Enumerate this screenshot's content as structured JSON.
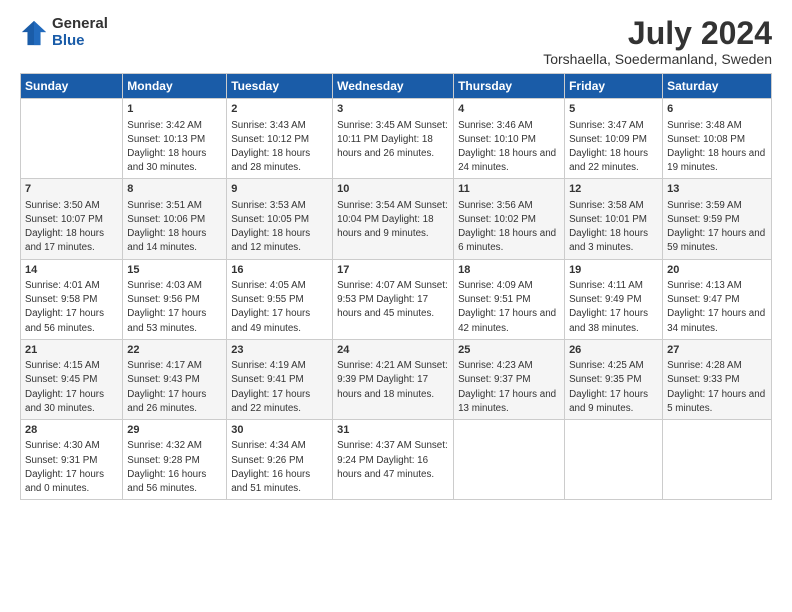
{
  "logo": {
    "general": "General",
    "blue": "Blue"
  },
  "title": "July 2024",
  "subtitle": "Torshaella, Soedermanland, Sweden",
  "days_of_week": [
    "Sunday",
    "Monday",
    "Tuesday",
    "Wednesday",
    "Thursday",
    "Friday",
    "Saturday"
  ],
  "weeks": [
    [
      {
        "num": "",
        "info": ""
      },
      {
        "num": "1",
        "info": "Sunrise: 3:42 AM\nSunset: 10:13 PM\nDaylight: 18 hours\nand 30 minutes."
      },
      {
        "num": "2",
        "info": "Sunrise: 3:43 AM\nSunset: 10:12 PM\nDaylight: 18 hours\nand 28 minutes."
      },
      {
        "num": "3",
        "info": "Sunrise: 3:45 AM\nSunset: 10:11 PM\nDaylight: 18 hours\nand 26 minutes."
      },
      {
        "num": "4",
        "info": "Sunrise: 3:46 AM\nSunset: 10:10 PM\nDaylight: 18 hours\nand 24 minutes."
      },
      {
        "num": "5",
        "info": "Sunrise: 3:47 AM\nSunset: 10:09 PM\nDaylight: 18 hours\nand 22 minutes."
      },
      {
        "num": "6",
        "info": "Sunrise: 3:48 AM\nSunset: 10:08 PM\nDaylight: 18 hours\nand 19 minutes."
      }
    ],
    [
      {
        "num": "7",
        "info": "Sunrise: 3:50 AM\nSunset: 10:07 PM\nDaylight: 18 hours\nand 17 minutes."
      },
      {
        "num": "8",
        "info": "Sunrise: 3:51 AM\nSunset: 10:06 PM\nDaylight: 18 hours\nand 14 minutes."
      },
      {
        "num": "9",
        "info": "Sunrise: 3:53 AM\nSunset: 10:05 PM\nDaylight: 18 hours\nand 12 minutes."
      },
      {
        "num": "10",
        "info": "Sunrise: 3:54 AM\nSunset: 10:04 PM\nDaylight: 18 hours\nand 9 minutes."
      },
      {
        "num": "11",
        "info": "Sunrise: 3:56 AM\nSunset: 10:02 PM\nDaylight: 18 hours\nand 6 minutes."
      },
      {
        "num": "12",
        "info": "Sunrise: 3:58 AM\nSunset: 10:01 PM\nDaylight: 18 hours\nand 3 minutes."
      },
      {
        "num": "13",
        "info": "Sunrise: 3:59 AM\nSunset: 9:59 PM\nDaylight: 17 hours\nand 59 minutes."
      }
    ],
    [
      {
        "num": "14",
        "info": "Sunrise: 4:01 AM\nSunset: 9:58 PM\nDaylight: 17 hours\nand 56 minutes."
      },
      {
        "num": "15",
        "info": "Sunrise: 4:03 AM\nSunset: 9:56 PM\nDaylight: 17 hours\nand 53 minutes."
      },
      {
        "num": "16",
        "info": "Sunrise: 4:05 AM\nSunset: 9:55 PM\nDaylight: 17 hours\nand 49 minutes."
      },
      {
        "num": "17",
        "info": "Sunrise: 4:07 AM\nSunset: 9:53 PM\nDaylight: 17 hours\nand 45 minutes."
      },
      {
        "num": "18",
        "info": "Sunrise: 4:09 AM\nSunset: 9:51 PM\nDaylight: 17 hours\nand 42 minutes."
      },
      {
        "num": "19",
        "info": "Sunrise: 4:11 AM\nSunset: 9:49 PM\nDaylight: 17 hours\nand 38 minutes."
      },
      {
        "num": "20",
        "info": "Sunrise: 4:13 AM\nSunset: 9:47 PM\nDaylight: 17 hours\nand 34 minutes."
      }
    ],
    [
      {
        "num": "21",
        "info": "Sunrise: 4:15 AM\nSunset: 9:45 PM\nDaylight: 17 hours\nand 30 minutes."
      },
      {
        "num": "22",
        "info": "Sunrise: 4:17 AM\nSunset: 9:43 PM\nDaylight: 17 hours\nand 26 minutes."
      },
      {
        "num": "23",
        "info": "Sunrise: 4:19 AM\nSunset: 9:41 PM\nDaylight: 17 hours\nand 22 minutes."
      },
      {
        "num": "24",
        "info": "Sunrise: 4:21 AM\nSunset: 9:39 PM\nDaylight: 17 hours\nand 18 minutes."
      },
      {
        "num": "25",
        "info": "Sunrise: 4:23 AM\nSunset: 9:37 PM\nDaylight: 17 hours\nand 13 minutes."
      },
      {
        "num": "26",
        "info": "Sunrise: 4:25 AM\nSunset: 9:35 PM\nDaylight: 17 hours\nand 9 minutes."
      },
      {
        "num": "27",
        "info": "Sunrise: 4:28 AM\nSunset: 9:33 PM\nDaylight: 17 hours\nand 5 minutes."
      }
    ],
    [
      {
        "num": "28",
        "info": "Sunrise: 4:30 AM\nSunset: 9:31 PM\nDaylight: 17 hours\nand 0 minutes."
      },
      {
        "num": "29",
        "info": "Sunrise: 4:32 AM\nSunset: 9:28 PM\nDaylight: 16 hours\nand 56 minutes."
      },
      {
        "num": "30",
        "info": "Sunrise: 4:34 AM\nSunset: 9:26 PM\nDaylight: 16 hours\nand 51 minutes."
      },
      {
        "num": "31",
        "info": "Sunrise: 4:37 AM\nSunset: 9:24 PM\nDaylight: 16 hours\nand 47 minutes."
      },
      {
        "num": "",
        "info": ""
      },
      {
        "num": "",
        "info": ""
      },
      {
        "num": "",
        "info": ""
      }
    ]
  ]
}
